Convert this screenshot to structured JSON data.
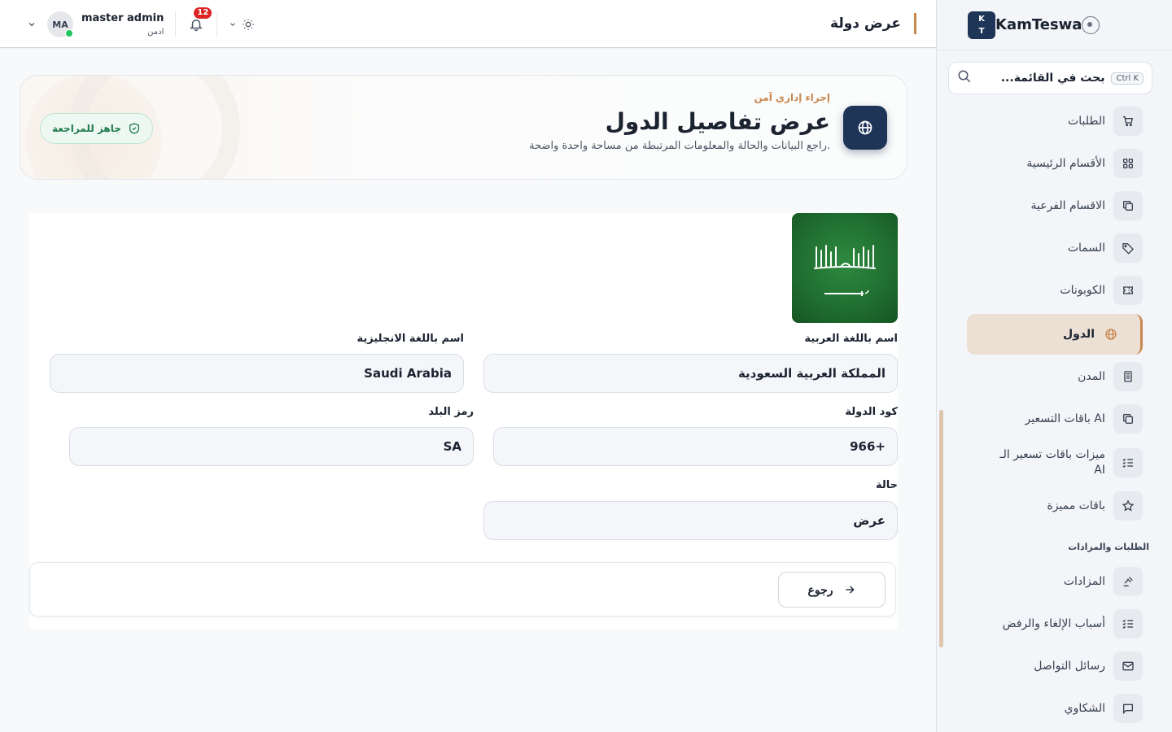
{
  "sidebar": {
    "logo_line1": "K",
    "logo_line2": "T",
    "brand": "KamTeswa",
    "search_placeholder": "بحث في القائمة...",
    "search_shortcut": "Ctrl K",
    "items": [
      {
        "label": "الطلبات",
        "icon": "cart-icon"
      },
      {
        "label": "الأقسام الرئيسية",
        "icon": "grid-icon"
      },
      {
        "label": "الاقسام الفرعية",
        "icon": "copy-icon"
      },
      {
        "label": "السمات",
        "icon": "tag-icon"
      },
      {
        "label": "الكوبونات",
        "icon": "ticket-icon"
      },
      {
        "label": "الدول",
        "icon": "globe-icon",
        "active": true
      },
      {
        "label": "المدن",
        "icon": "building-icon"
      },
      {
        "label": "باقات التسعير AI",
        "icon": "copy-icon"
      },
      {
        "label": "ميزات باقات تسعير الـ AI",
        "icon": "list-check-icon"
      },
      {
        "label": "باقات مميزة",
        "icon": "star-icon"
      }
    ],
    "section_title": "الطلبات والمزادات",
    "section_items": [
      {
        "label": "المزادات",
        "icon": "gavel-icon"
      },
      {
        "label": "أسباب الإلغاء والرفض",
        "icon": "list-check-icon"
      },
      {
        "label": "رسائل التواصل",
        "icon": "mail-icon"
      },
      {
        "label": "الشكاوي",
        "icon": "message-icon"
      }
    ]
  },
  "topbar": {
    "page_title": "عرض دولة",
    "user_name": "master admin",
    "user_role": "ادمن",
    "avatar_initials": "MA",
    "notification_count": "12"
  },
  "hero": {
    "kicker": "إجراء إداري آمن",
    "title": "عرض تفاصيل الدول",
    "subtitle": "راجع البيانات والحالة والمعلومات المرتبطة من مساحة واحدة واضحة.",
    "status_pill": "جاهز للمراجعة"
  },
  "form": {
    "name_ar_label": "اسم باللغة العربية",
    "name_ar_value": "المملكة العربية السعودية",
    "name_en_label": "اسم باللغة الانجليزية",
    "name_en_value": "Saudi Arabia",
    "country_code_label": "كود الدولة",
    "country_code_value": "966+",
    "iso_label": "رمز البلد",
    "iso_value": "SA",
    "status_label": "حالة",
    "status_value": "عرض",
    "back_button": "رجوع"
  },
  "colors": {
    "accent": "#c8874f",
    "brand_navy": "#1f3557",
    "success": "#1f7a4c",
    "danger": "#dc2626"
  }
}
